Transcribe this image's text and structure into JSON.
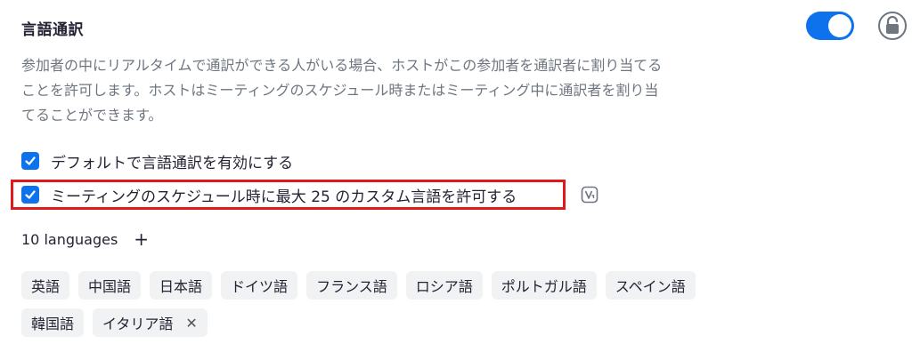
{
  "section": {
    "title": "言語通訳",
    "toggle_on": true,
    "description_lines": [
      "参加者の中にリアルタイムで通訳ができる人がいる場合、ホストがこの参加者を通訳者に割り当てる",
      "ことを許可します。ホストはミーティングのスケジュール時またはミーティング中に通訳者を割り当",
      "てることができます。"
    ]
  },
  "options": [
    {
      "label": "デフォルトで言語通訳を有効にする",
      "checked": true
    },
    {
      "label": "ミーティングのスケジュール時に最大 25 のカスタム言語を許可する",
      "checked": true
    }
  ],
  "languages": {
    "count_label": "10 languages",
    "add_icon": "plus-icon",
    "items": [
      "英語",
      "中国語",
      "日本語",
      "ドイツ語",
      "フランス語",
      "ロシア語",
      "ポルトガル語",
      "スペイン語",
      "韓国語",
      "イタリア語"
    ]
  },
  "colors": {
    "accent": "#0e72ed",
    "highlight_border": "#e01a1a",
    "chip_bg": "#f1f2f4"
  }
}
